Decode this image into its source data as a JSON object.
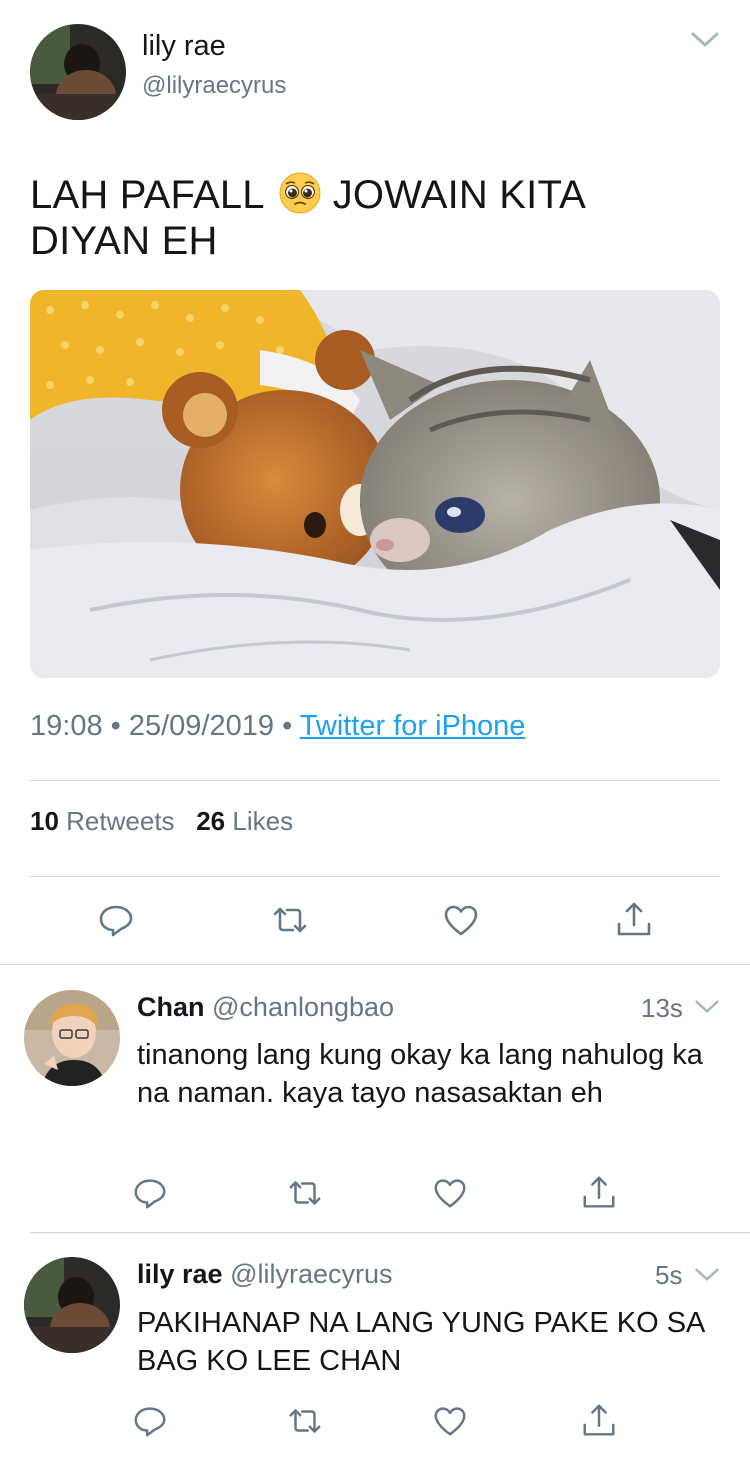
{
  "tweet": {
    "author_name": "lily rae",
    "author_handle": "@lilyraecyrus",
    "text_part1": "LAH PAFALL",
    "text_emoji": "pleading-face-emoji",
    "text_part2": "JOWAIN KITA DIYAN EH",
    "media": "crying-cat-with-teddy-bear-photo",
    "time": "19:08",
    "date": "25/09/2019",
    "source": "Twitter for iPhone",
    "retweets_count": "10",
    "retweets_label": "Retweets",
    "likes_count": "26",
    "likes_label": "Likes"
  },
  "actions": [
    "reply-icon",
    "retweet-icon",
    "like-icon",
    "share-icon"
  ],
  "replies": [
    {
      "name": "Chan",
      "handle": "@chanlongbao",
      "time": "13s",
      "text": "tinanong lang kung okay ka lang nahulog ka na naman. kaya tayo nasasaktan eh"
    },
    {
      "name": "lily rae",
      "handle": "@lilyraecyrus",
      "time": "5s",
      "text": "PAKIHANAP NA LANG YUNG PAKE KO SA BAG KO LEE CHAN"
    }
  ],
  "colors": {
    "link": "#1da1f2",
    "secondary": "#657786",
    "icon": "#657786",
    "divider": "#ccd6dd"
  }
}
